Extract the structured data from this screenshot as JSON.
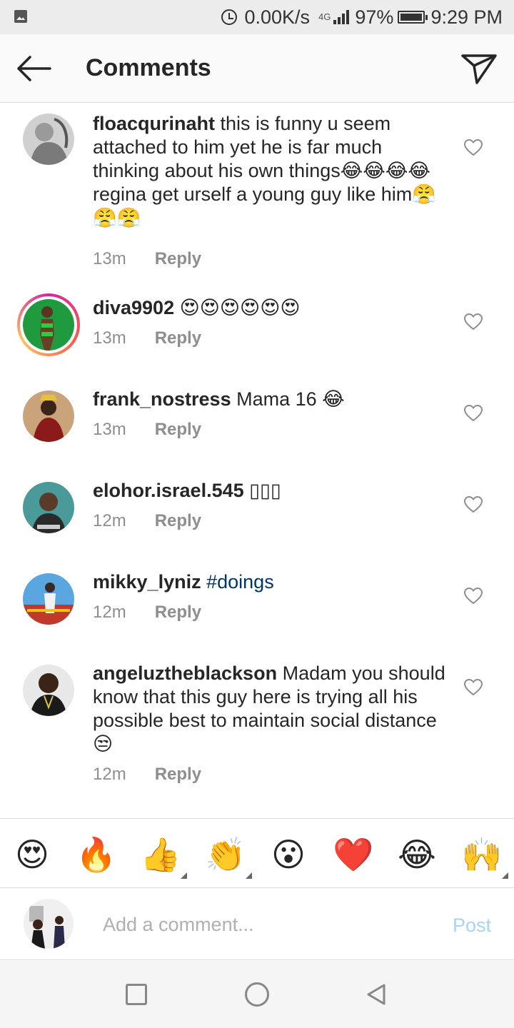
{
  "status_bar": {
    "speed": "0.00K/s",
    "network": "4G",
    "battery": "97%",
    "time": "9:29 PM"
  },
  "header": {
    "title": "Comments",
    "back_icon": "arrow-left-icon",
    "send_icon": "paper-plane-icon"
  },
  "comments": [
    {
      "username": "floacqurinaht",
      "text": "this is funny u seem attached to him yet he is far much thinking about his own things😂😂😂😂 regina get urself a young guy like him😤😤😤",
      "time": "13m",
      "reply": "Reply"
    },
    {
      "username": "diva9902",
      "text": "😍😍😍😍😍😍",
      "time": "13m",
      "reply": "Reply"
    },
    {
      "username": "frank_nostress",
      "text": "Mama 16 😂",
      "time": "13m",
      "reply": "Reply"
    },
    {
      "username": "elohor.israel.545",
      "text": "▯▯▯",
      "time": "12m",
      "reply": "Reply"
    },
    {
      "username": "mikky_lyniz",
      "text": "#doings",
      "time": "12m",
      "reply": "Reply"
    },
    {
      "username": "angeluztheblackson",
      "text": "Madam you should know that this guy here is trying all his possible best to maintain social distance 😒",
      "time": "12m",
      "reply": "Reply"
    }
  ],
  "reactions": [
    "😍",
    "🔥",
    "👍",
    "👏",
    "😮",
    "❤️",
    "😂",
    "🙌"
  ],
  "composer": {
    "placeholder": "Add a comment...",
    "post_label": "Post"
  },
  "colors": {
    "link_blue": "#003569",
    "post_disabled": "#a9d4f7",
    "meta_gray": "#8e8e8e"
  }
}
